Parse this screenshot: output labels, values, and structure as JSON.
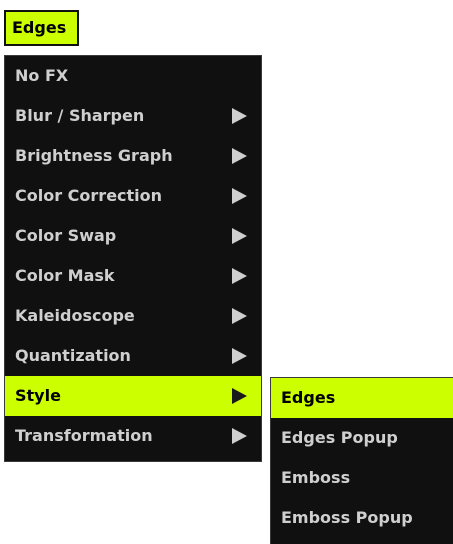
{
  "dropdown": {
    "label": "Edges"
  },
  "main_menu": {
    "items": [
      {
        "label": "No FX",
        "has_submenu": false
      },
      {
        "label": "Blur / Sharpen",
        "has_submenu": true
      },
      {
        "label": "Brightness Graph",
        "has_submenu": true
      },
      {
        "label": "Color Correction",
        "has_submenu": true
      },
      {
        "label": "Color Swap",
        "has_submenu": true
      },
      {
        "label": "Color Mask",
        "has_submenu": true
      },
      {
        "label": "Kaleidoscope",
        "has_submenu": true
      },
      {
        "label": "Quantization",
        "has_submenu": true
      },
      {
        "label": "Style",
        "has_submenu": true,
        "selected": true
      },
      {
        "label": "Transformation",
        "has_submenu": true
      }
    ]
  },
  "sub_menu": {
    "items": [
      {
        "label": "Edges",
        "selected": true
      },
      {
        "label": "Edges Popup"
      },
      {
        "label": "Emboss"
      },
      {
        "label": "Emboss Popup"
      }
    ]
  },
  "colors": {
    "highlight": "#ccff00",
    "menu_background": "#101010",
    "menu_text": "#cfcfcf"
  },
  "icons": {
    "submenu_arrow": "chevron-right-icon"
  }
}
